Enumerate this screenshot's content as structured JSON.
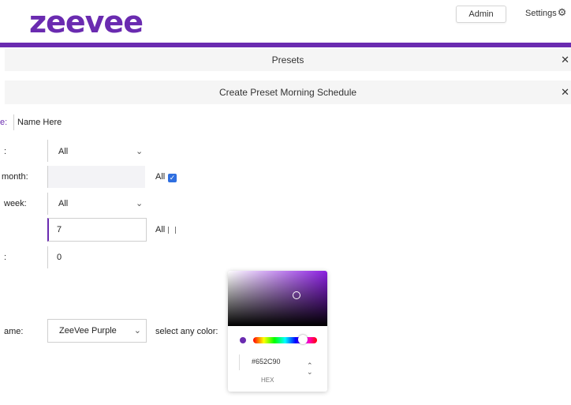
{
  "header": {
    "logo_text": "zeevee",
    "admin_label": "Admin",
    "settings_label": "Settings",
    "settings_icon": "gear-icon"
  },
  "presets_band": {
    "title": "Presets",
    "close_icon": "close-icon",
    "close_glyph": "✕"
  },
  "create_band": {
    "title": "Create Preset Morning Schedule",
    "close_glyph": "✕"
  },
  "form": {
    "name": {
      "label_prefix": "e:",
      "value": "Name Here"
    },
    "row1": {
      "label": ":",
      "value": "All"
    },
    "month": {
      "label": "month:",
      "all_label": "All",
      "all_checked": true
    },
    "week": {
      "label": "week:",
      "value": "All"
    },
    "hour": {
      "value": "7",
      "all_label": "All",
      "all_checked": false
    },
    "row5": {
      "label": ":",
      "value": "0"
    },
    "theme": {
      "label": "ame:",
      "value": "ZeeVee Purple",
      "color_prompt": "select any color:"
    }
  },
  "color_picker": {
    "hex_value": "#652C90",
    "format_label": "HEX",
    "selected_color": "#6a2bb0"
  },
  "colors": {
    "brand_purple": "#6a2bb0",
    "band_bg": "#f5f5f5",
    "checkbox_blue": "#2f6fe0"
  }
}
